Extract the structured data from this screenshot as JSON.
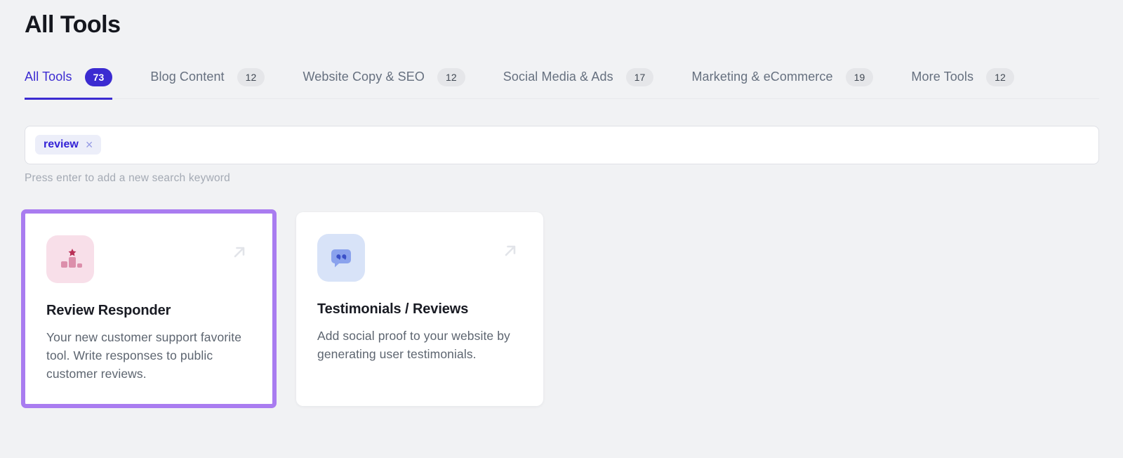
{
  "page": {
    "title": "All Tools"
  },
  "tabs": [
    {
      "label": "All Tools",
      "count": "73",
      "active": true
    },
    {
      "label": "Blog Content",
      "count": "12",
      "active": false
    },
    {
      "label": "Website Copy & SEO",
      "count": "12",
      "active": false
    },
    {
      "label": "Social Media & Ads",
      "count": "17",
      "active": false
    },
    {
      "label": "Marketing & eCommerce",
      "count": "19",
      "active": false
    },
    {
      "label": "More Tools",
      "count": "12",
      "active": false
    }
  ],
  "search": {
    "tags": [
      {
        "label": "review",
        "remove_icon": "×"
      }
    ],
    "input_value": "",
    "helper_text": "Press enter to add a new search keyword"
  },
  "cards": [
    {
      "title": "Review Responder",
      "description": "Your new customer support favorite tool. Write responses to public customer reviews.",
      "icon": "review-bars-star-icon",
      "highlighted": true
    },
    {
      "title": "Testimonials / Reviews",
      "description": "Add social proof to your website by generating user testimonials.",
      "icon": "speech-bubble-quote-icon",
      "highlighted": false
    }
  ],
  "colors": {
    "accent_indigo": "#3B2BD1",
    "highlight_purple": "#A97CF0",
    "page_background": "#F1F2F4",
    "card_background": "#FFFFFF",
    "pink_tile": "#F8DFE9",
    "pink_icon_bar": "#DC8FAB",
    "pink_icon_star": "#B93157",
    "blue_tile": "#D8E3F8",
    "blue_icon_bubble": "#8AA2ED",
    "blue_icon_quote": "#3A50C8",
    "chip_background": "#ECEEF9",
    "inactive_tab_text": "#66707F",
    "muted_text": "#A4AAB4"
  }
}
